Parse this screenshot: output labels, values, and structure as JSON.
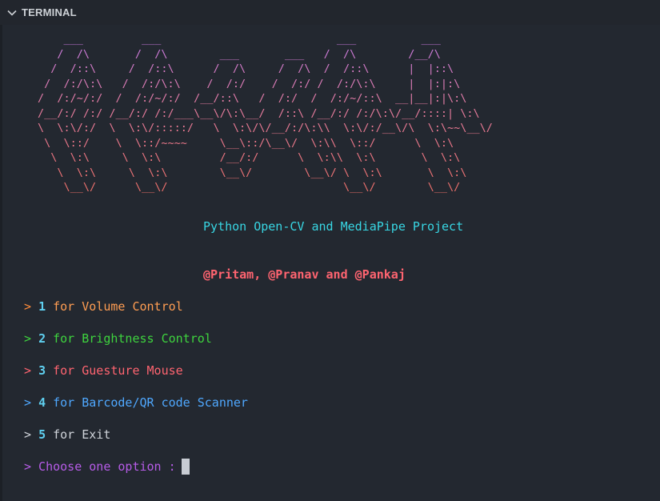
{
  "panel": {
    "title": "TERMINAL",
    "chevron_icon": "chevron-down-icon"
  },
  "terminal": {
    "banner": "    ___         ___                           ___          ___\n   /  /\\       /  /\\        ___       ___   /  /\\        /__/\\\n  /  /::\\     /  /::\\      /  /\\     /  /\\  /  /::\\      |  |::\\\n /  /:/\\:\\   /  /:/\\:\\    /  /:/    /  /:/ /  /:/\\:\\     |  |:|:\\\n/  /:/~/:/  /  /:/~/:/  /__/::\\   /  /:/  /  /:/~/::\\  __|__|:|\\:\\\n/__/:/ /:/ /__/:/ /:/___\\__\\/\\:\\__/  /::\\ /__/:/ /:/\\:\\/__/::::| \\:\\\n\\  \\:\\/:/  \\  \\:\\/:::::/   \\  \\:\\/\\/__/:/\\:\\\\  \\:\\/:/__\\/\\  \\:\\~~\\__\\/\n \\  \\::/    \\  \\::/~~~~     \\__\\::/\\__\\/  \\:\\\\  \\::/      \\  \\:\\\n  \\  \\:\\     \\  \\:\\         /__/:/      \\  \\:\\\\  \\:\\       \\  \\:\\\n   \\  \\:\\     \\  \\:\\        \\__\\/        \\__\\/ \\  \\:\\       \\  \\:\\\n    \\__\\/      \\__\\/                           \\__\\/        \\__\\/",
    "subtitle": "Python Open-CV and MediaPipe Project",
    "authors": "@Pritam, @Pranav and @Pankaj",
    "menu": [
      {
        "arrow": ">",
        "number": "1",
        "for": "for",
        "label": "Volume Control",
        "arrow_color": "#ff8c3a",
        "text_color": "#ff9d52"
      },
      {
        "arrow": ">",
        "number": "2",
        "for": "for",
        "label": "Brightness Control",
        "arrow_color": "#3ed43e",
        "text_color": "#3ed43e"
      },
      {
        "arrow": ">",
        "number": "3",
        "for": "for",
        "label": "Guesture Mouse",
        "arrow_color": "#ff6470",
        "text_color": "#ff6470"
      },
      {
        "arrow": ">",
        "number": "4",
        "for": "for",
        "label": "Barcode/QR code Scanner",
        "arrow_color": "#4fa8ff",
        "text_color": "#4fa8ff"
      },
      {
        "arrow": ">",
        "number": "5",
        "for": "for",
        "label": "Exit",
        "arrow_color": "#d0d4da",
        "text_color": "#d0d4da"
      }
    ],
    "prompt": "> Choose one option : "
  }
}
